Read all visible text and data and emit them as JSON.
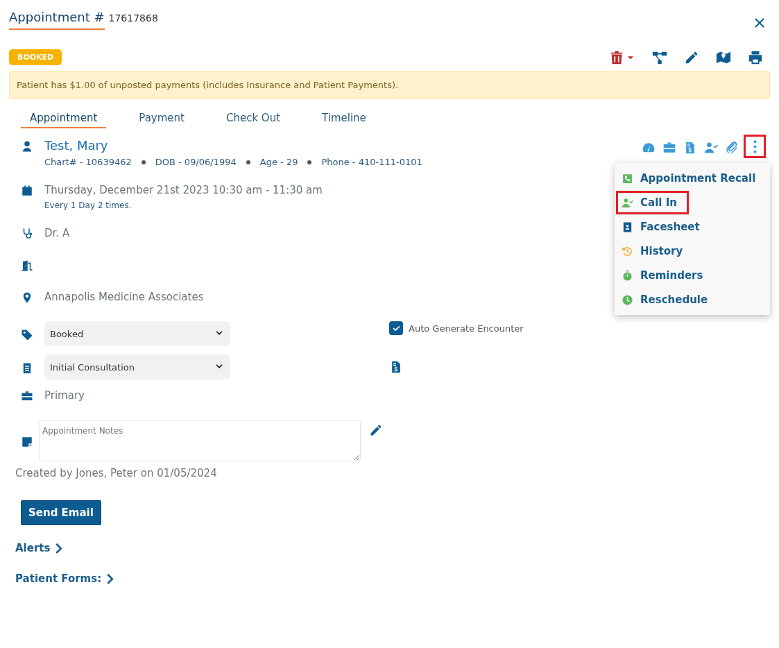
{
  "title": {
    "label": "Appointment #",
    "number": "17617868"
  },
  "status_badge": "BOOKED",
  "toolbar": [
    {
      "kind": "delete"
    },
    {
      "kind": "workflow"
    },
    {
      "kind": "edit"
    },
    {
      "kind": "map"
    },
    {
      "kind": "print"
    }
  ],
  "alert": "Patient has $1.00 of unposted payments (includes Insurance and Patient Payments).",
  "tabs": [
    {
      "label": "Appointment",
      "selected": true
    },
    {
      "label": "Payment",
      "selected": false
    },
    {
      "label": "Check Out",
      "selected": false
    },
    {
      "label": "Timeline",
      "selected": false
    }
  ],
  "patient": {
    "name": "Test, Mary",
    "details": [
      "Chart# - 10639462",
      "DOB - 09/06/1994",
      "Age - 29",
      "Phone - 410-111-0101"
    ]
  },
  "quick_actions": [
    {
      "kind": "dashboard",
      "highlighted": false
    },
    {
      "kind": "briefcase",
      "highlighted": false
    },
    {
      "kind": "invoice",
      "highlighted": false
    },
    {
      "kind": "user-check",
      "highlighted": false
    },
    {
      "kind": "attachment",
      "highlighted": false
    },
    {
      "kind": "more",
      "highlighted": true
    }
  ],
  "menu": [
    {
      "label": "Appointment Recall",
      "kind": "phone",
      "color": "#5cb85c",
      "highlighted": false
    },
    {
      "label": "Call In",
      "kind": "user-check",
      "color": "#5cb85c",
      "highlighted": true
    },
    {
      "label": "Facesheet",
      "kind": "contact",
      "color": "#0d5c91",
      "highlighted": false
    },
    {
      "label": "History",
      "kind": "history",
      "color": "#f5a623",
      "highlighted": false
    },
    {
      "label": "Reminders",
      "kind": "stopwatch",
      "color": "#5cb85c",
      "highlighted": false
    },
    {
      "label": "Reschedule",
      "kind": "clock",
      "color": "#5cb85c",
      "highlighted": false
    }
  ],
  "schedule": {
    "datetime": "Thursday, December 21st 2023 10:30 am - 11:30 am",
    "recurrence": "Every 1 Day 2 times."
  },
  "provider": "Dr. A",
  "location": "Annapolis Medicine Associates",
  "status_select": "Booked",
  "type_select": "Initial Consultation",
  "auto_generate": {
    "label": "Auto Generate Encounter",
    "checked": true
  },
  "insurance": "Primary",
  "notes": {
    "placeholder": "Appointment Notes"
  },
  "created": "Created by Jones, Peter on 01/05/2024",
  "send_button": "Send Email",
  "sections": [
    "Alerts",
    "Patient Forms:"
  ]
}
